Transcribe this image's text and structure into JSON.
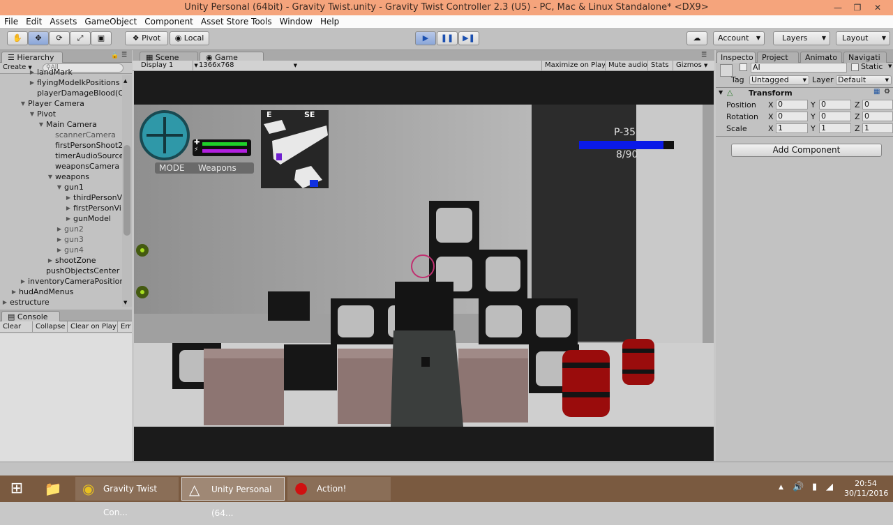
{
  "window": {
    "title": "Unity Personal (64bit) - Gravity Twist.unity - Gravity Twist Controller 2.3 (U5) - PC, Mac & Linux Standalone* <DX9>",
    "minimize_icon": "minimize-icon",
    "maximize_icon": "restore-icon",
    "close_icon": "close-icon"
  },
  "menu": [
    "File",
    "Edit",
    "Assets",
    "GameObject",
    "Component",
    "Asset Store Tools",
    "Window",
    "Help"
  ],
  "toolbar": {
    "pivot_label": "Pivot",
    "local_label": "Local",
    "account_label": "Account",
    "layers_label": "Layers",
    "layout_label": "Layout"
  },
  "hierarchy": {
    "tab_label": "Hierarchy",
    "create_label": "Create",
    "search_placeholder": "All",
    "rows": [
      {
        "label": "landMark",
        "indent": 3,
        "arrow": "▶",
        "dim": false
      },
      {
        "label": "flyingModeIkPositions",
        "indent": 3,
        "arrow": "▶",
        "dim": false
      },
      {
        "label": "playerDamageBlood(C",
        "indent": 3,
        "arrow": "",
        "dim": false
      },
      {
        "label": "Player Camera",
        "indent": 2,
        "arrow": "▼",
        "dim": false
      },
      {
        "label": "Pivot",
        "indent": 3,
        "arrow": "▼",
        "dim": false
      },
      {
        "label": "Main Camera",
        "indent": 4,
        "arrow": "▼",
        "dim": false
      },
      {
        "label": "scannerCamera",
        "indent": 5,
        "arrow": "",
        "dim": true
      },
      {
        "label": "firstPersonShoot2",
        "indent": 5,
        "arrow": "",
        "dim": false
      },
      {
        "label": "timerAudioSource",
        "indent": 5,
        "arrow": "",
        "dim": false
      },
      {
        "label": "weaponsCamera",
        "indent": 5,
        "arrow": "",
        "dim": false
      },
      {
        "label": "weapons",
        "indent": 5,
        "arrow": "▼",
        "dim": false
      },
      {
        "label": "gun1",
        "indent": 6,
        "arrow": "▼",
        "dim": false
      },
      {
        "label": "thirdPersonV",
        "indent": 7,
        "arrow": "▶",
        "dim": false
      },
      {
        "label": "firstPersonVi",
        "indent": 7,
        "arrow": "▶",
        "dim": false
      },
      {
        "label": "gunModel",
        "indent": 7,
        "arrow": "▶",
        "dim": false
      },
      {
        "label": "gun2",
        "indent": 6,
        "arrow": "▶",
        "dim": true
      },
      {
        "label": "gun3",
        "indent": 6,
        "arrow": "▶",
        "dim": true
      },
      {
        "label": "gun4",
        "indent": 6,
        "arrow": "▶",
        "dim": true
      },
      {
        "label": "shootZone",
        "indent": 5,
        "arrow": "▶",
        "dim": false
      },
      {
        "label": "pushObjectsCenter",
        "indent": 4,
        "arrow": "",
        "dim": false
      },
      {
        "label": "inventoryCameraPosition",
        "indent": 2,
        "arrow": "▶",
        "dim": false
      },
      {
        "label": "hudAndMenus",
        "indent": 1,
        "arrow": "▶",
        "dim": false
      },
      {
        "label": "estructure",
        "indent": 0,
        "arrow": "▶",
        "dim": false
      }
    ]
  },
  "console": {
    "tab_label": "Console",
    "clear_label": "Clear",
    "collapse_label": "Collapse",
    "clear_on_play_label": "Clear on Play",
    "error_pause_label": "Err"
  },
  "scene_tabs": {
    "scene_label": "Scene",
    "game_label": "Game",
    "display_label": "Display 1",
    "resolution_label": "1366x768",
    "maximize_label": "Maximize on Play",
    "mute_label": "Mute audio",
    "stats_label": "Stats",
    "gizmos_label": "Gizmos"
  },
  "hud": {
    "mode_label": "MODE",
    "weapons_label": "Weapons",
    "compass_e": "E",
    "compass_se": "SE",
    "weapon_name": "P-35",
    "ammo": "8/90",
    "health_fraction": 1.0,
    "energy_fraction": 1.0,
    "ammo_fraction": 0.89,
    "health_color": "#1fd02a",
    "energy_color": "#b21fe0",
    "ammo_bar_color": "#0a1ae8"
  },
  "inspector": {
    "tabs": [
      "Inspecto",
      "Project",
      "Animato",
      "Navigati"
    ],
    "object_name": "AI",
    "static_label": "Static",
    "tag_label": "Tag",
    "tag_value": "Untagged",
    "layer_label": "Layer",
    "layer_value": "Default",
    "transform_label": "Transform",
    "position_label": "Position",
    "rotation_label": "Rotation",
    "scale_label": "Scale",
    "position": {
      "x": "0",
      "y": "0",
      "z": "0"
    },
    "rotation": {
      "x": "0",
      "y": "0",
      "z": "0"
    },
    "scale": {
      "x": "1",
      "y": "1",
      "z": "1"
    },
    "axis_x": "X",
    "axis_y": "Y",
    "axis_z": "Z",
    "add_component_label": "Add Component"
  },
  "taskbar": {
    "chrome_label": "Gravity Twist Con...",
    "unity_label": "Unity Personal (64...",
    "action_label": "Action!",
    "time": "20:54",
    "date": "30/11/2016"
  }
}
